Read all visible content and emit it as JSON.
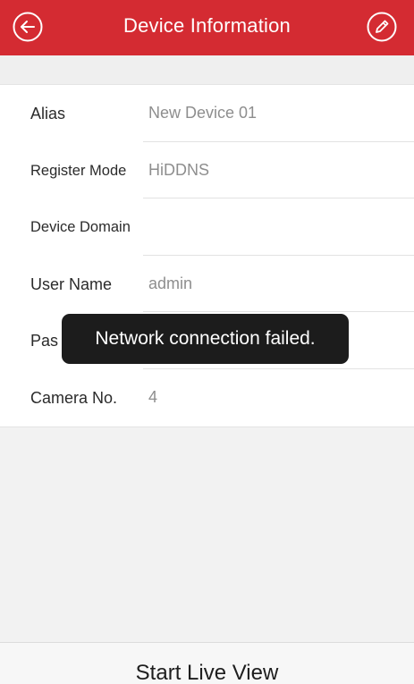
{
  "header": {
    "title": "Device Information",
    "back_icon": "back-arrow-icon",
    "edit_icon": "pencil-edit-icon",
    "bar_color": "#d42b32"
  },
  "fields": [
    {
      "label": "Alias",
      "value": "New Device 01"
    },
    {
      "label": "Register Mode",
      "value": "HiDDNS"
    },
    {
      "label": "Device Domain",
      "value": ""
    },
    {
      "label": "User Name",
      "value": "admin"
    },
    {
      "label": "Pas",
      "value": ""
    },
    {
      "label": "Camera No.",
      "value": "4"
    }
  ],
  "toast": {
    "message": "Network connection failed."
  },
  "footer": {
    "action_label": "Start Live View"
  }
}
